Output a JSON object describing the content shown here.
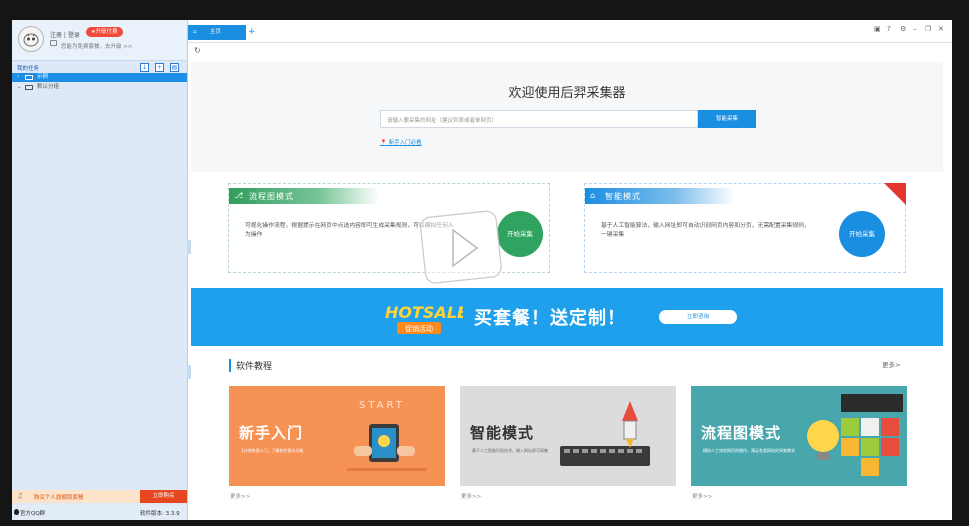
{
  "sidebar": {
    "login": "注册 | 登录",
    "vip": "升级付费",
    "tip": "您能为免费套餐，去升级 >>",
    "tasks_title": "我的任务",
    "tree": [
      {
        "label": "示例",
        "selected": true
      },
      {
        "label": "默认分组",
        "selected": false
      }
    ],
    "promo_text": "购买个人旗舰版套餐",
    "promo_btn": "立即购买",
    "qq_label": "官方QQ群",
    "version": "软件版本: 3.3.9"
  },
  "tabs": [
    {
      "label": "主页"
    }
  ],
  "tab_add": "+",
  "hero": {
    "title": "欢迎使用后羿采集器",
    "placeholder": "请输入要采集的网址（建议列表或者单网页）",
    "search_btn": "智能采集",
    "guide_link": "新手入门必看"
  },
  "modes": [
    {
      "name": "流程图模式",
      "desc": "可视化操作流程，根据提示在网页中点选内容即可生成采集规则，可以模拟任何人为操作",
      "btn": "开始采集",
      "color": "#2fa35f"
    },
    {
      "name": "智能模式",
      "desc": "基于人工智能算法，输入网址即可自动识别网页内容和分页，无需配置采集规则，一键采集",
      "btn": "开始采集",
      "color": "#1a8ee1"
    }
  ],
  "banner": {
    "hot": "HOTSALE",
    "hot_sub": "促销活动",
    "text": "买套餐！送定制！",
    "btn": "立即咨询"
  },
  "tutorials": {
    "title": "软件教程",
    "more": "更多>",
    "cards": [
      {
        "title": "新手入门",
        "sub": "3分钟快速入门，了解软件基本功能",
        "more": "更多>>",
        "bg": "#f79255",
        "word": "START"
      },
      {
        "title": "智能模式",
        "sub": "基于人工智能识别技术，输入网址即可采集",
        "more": "更多>>",
        "bg": "#dcdcdc"
      },
      {
        "title": "流程图模式",
        "sub": "模拟人工浏览网页的操作，满足各类网站的采集需求",
        "more": "更多>>",
        "bg": "#48a6ad"
      }
    ]
  }
}
